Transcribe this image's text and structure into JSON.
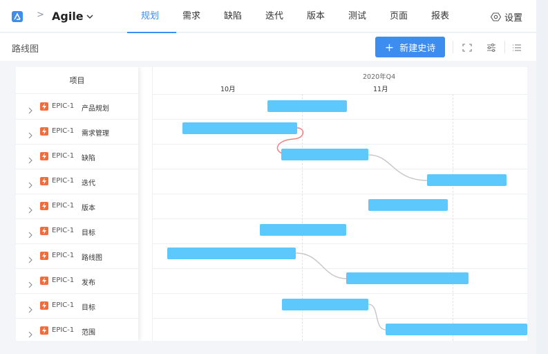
{
  "header": {
    "separator": ">",
    "project_name": "Agile",
    "tabs": [
      "规划",
      "需求",
      "缺陷",
      "迭代",
      "版本",
      "测试",
      "页面",
      "报表"
    ],
    "active_tab": "规划",
    "settings_label": "设置"
  },
  "toolbar": {
    "page_title": "路线图",
    "new_button_label": "新建史诗",
    "new_button_plus": "+"
  },
  "gantt": {
    "column_header": "项目",
    "quarter_label": "2020年Q4",
    "months": [
      "10月",
      "11月"
    ],
    "rows": [
      {
        "key": "EPIC-1",
        "title": "产品规划"
      },
      {
        "key": "EPIC-1",
        "title": "需求管理"
      },
      {
        "key": "EPIC-1",
        "title": "缺陷"
      },
      {
        "key": "EPIC-1",
        "title": "迭代"
      },
      {
        "key": "EPIC-1",
        "title": "版本"
      },
      {
        "key": "EPIC-1",
        "title": "目标"
      },
      {
        "key": "EPIC-1",
        "title": "路线图"
      },
      {
        "key": "EPIC-1",
        "title": "发布"
      },
      {
        "key": "EPIC-1",
        "title": "目标"
      },
      {
        "key": "EPIC-1",
        "title": "范围"
      }
    ]
  },
  "colors": {
    "accent": "#3d8cf0",
    "bar": "#5cc8fc",
    "epic_icon": "#f26b3a",
    "link_line": "#c8c8c8",
    "link_line_conflict": "#f08080"
  }
}
